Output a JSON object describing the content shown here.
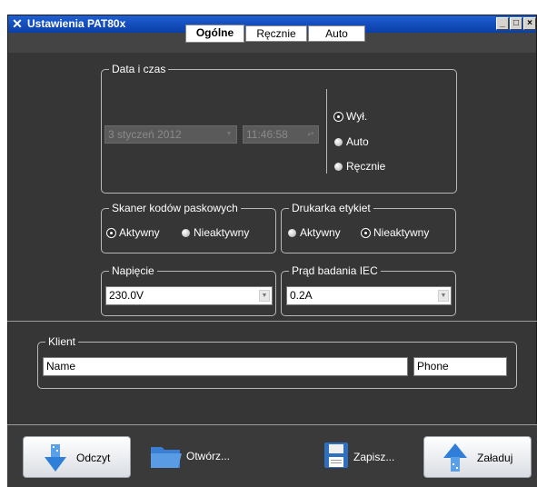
{
  "window": {
    "title": "Ustawienia PAT80x"
  },
  "tabs": [
    {
      "label": "Ogólne"
    },
    {
      "label": "Ręcznie"
    },
    {
      "label": "Auto"
    }
  ],
  "datetime": {
    "legend": "Data i czas",
    "date_value": "3 styczeń  2012",
    "time_value": "11:46:58",
    "mode_options": [
      {
        "label": "Wył."
      },
      {
        "label": "Auto"
      },
      {
        "label": "Ręcznie"
      }
    ],
    "selected": "Wył."
  },
  "scanner": {
    "legend": "Skaner kodów paskowych",
    "options": [
      {
        "label": "Aktywny"
      },
      {
        "label": "Nieaktywny"
      }
    ],
    "selected": "Aktywny"
  },
  "printer": {
    "legend": "Drukarka etykiet",
    "options": [
      {
        "label": "Aktywny"
      },
      {
        "label": "Nieaktywny"
      }
    ],
    "selected": "Nieaktywny"
  },
  "voltage": {
    "legend": "Napięcie",
    "value": "230.0V"
  },
  "iec_current": {
    "legend": "Prąd badania IEC",
    "value": "0.2A"
  },
  "client": {
    "legend": "Klient",
    "name_value": "Name",
    "phone_value": "Phone"
  },
  "actions": {
    "read": "Odczyt",
    "open": "Otwórz...",
    "save": "Zapisz...",
    "load": "Załaduj"
  }
}
